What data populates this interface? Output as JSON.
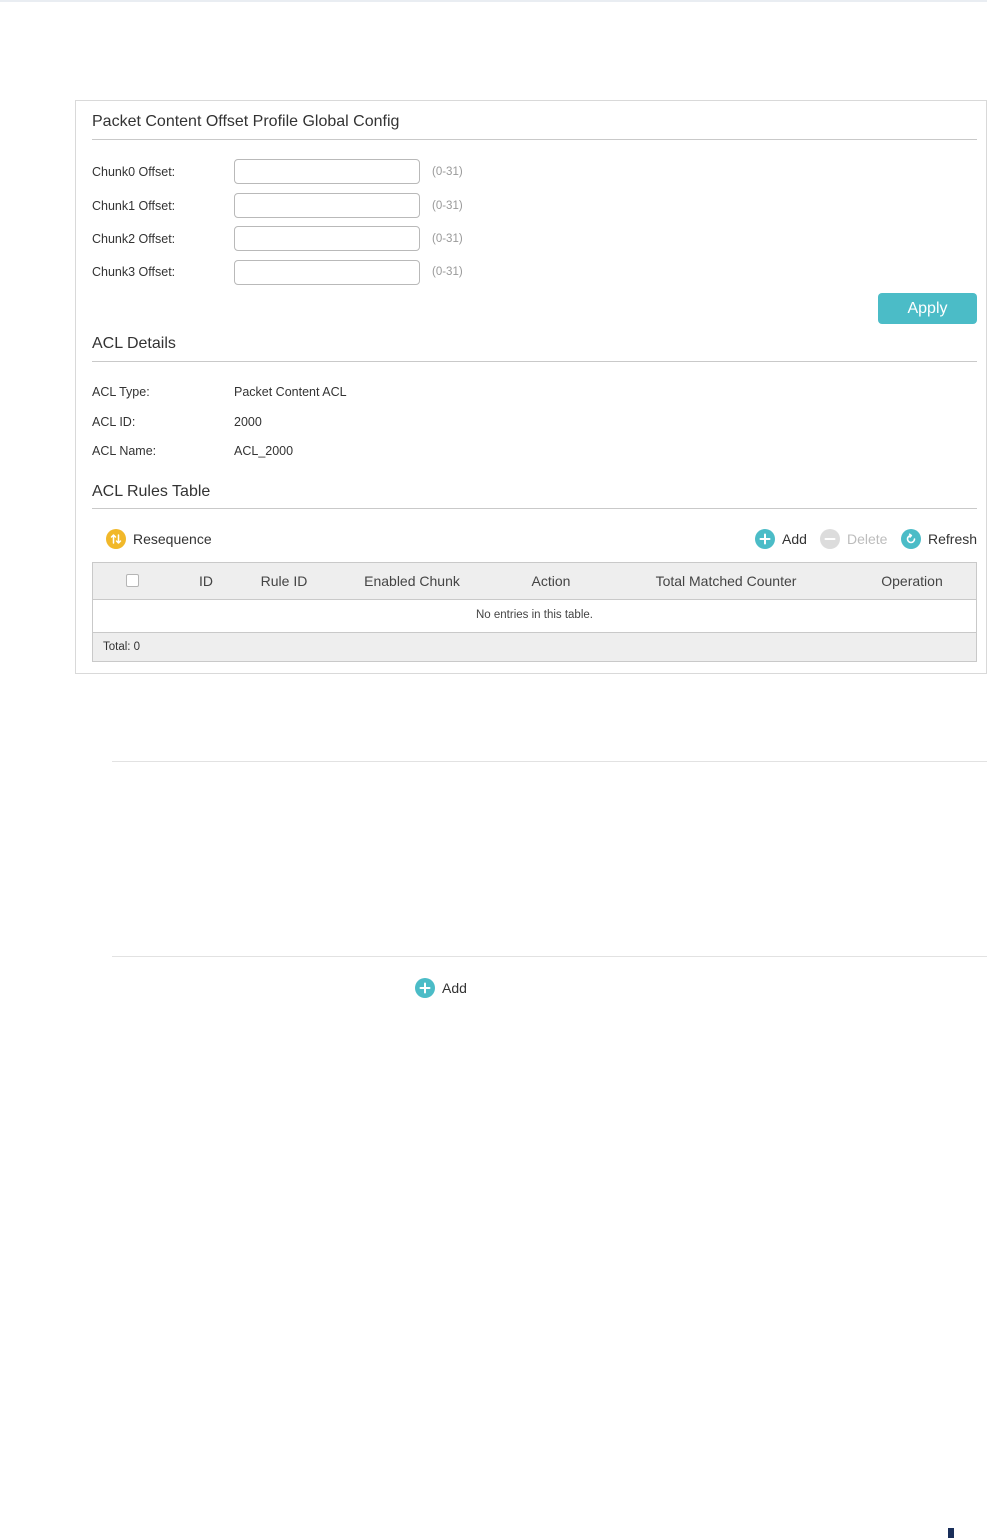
{
  "global_config": {
    "title": "Packet Content Offset Profile Global Config",
    "fields": [
      {
        "label": "Chunk0 Offset:",
        "value": "",
        "hint": "(0-31)"
      },
      {
        "label": "Chunk1 Offset:",
        "value": "",
        "hint": "(0-31)"
      },
      {
        "label": "Chunk2 Offset:",
        "value": "",
        "hint": "(0-31)"
      },
      {
        "label": "Chunk3 Offset:",
        "value": "",
        "hint": "(0-31)"
      }
    ],
    "apply_label": "Apply"
  },
  "acl_details": {
    "title": "ACL Details",
    "type_label": "ACL Type:",
    "type_value": "Packet Content ACL",
    "id_label": "ACL ID:",
    "id_value": "2000",
    "name_label": "ACL Name:",
    "name_value": "ACL_2000"
  },
  "rules_table": {
    "title": "ACL Rules Table",
    "toolbar": {
      "resequence": "Resequence",
      "add": "Add",
      "delete": "Delete",
      "refresh": "Refresh"
    },
    "columns": [
      "ID",
      "Rule ID",
      "Enabled Chunk",
      "Action",
      "Total Matched Counter",
      "Operation"
    ],
    "empty_text": "No entries in this table.",
    "total": "Total: 0"
  },
  "lower": {
    "add_label": "Add"
  },
  "colors": {
    "accent": "#4bbcc7",
    "resequence_icon": "#f1b82a",
    "disabled": "#d0d0d0"
  }
}
